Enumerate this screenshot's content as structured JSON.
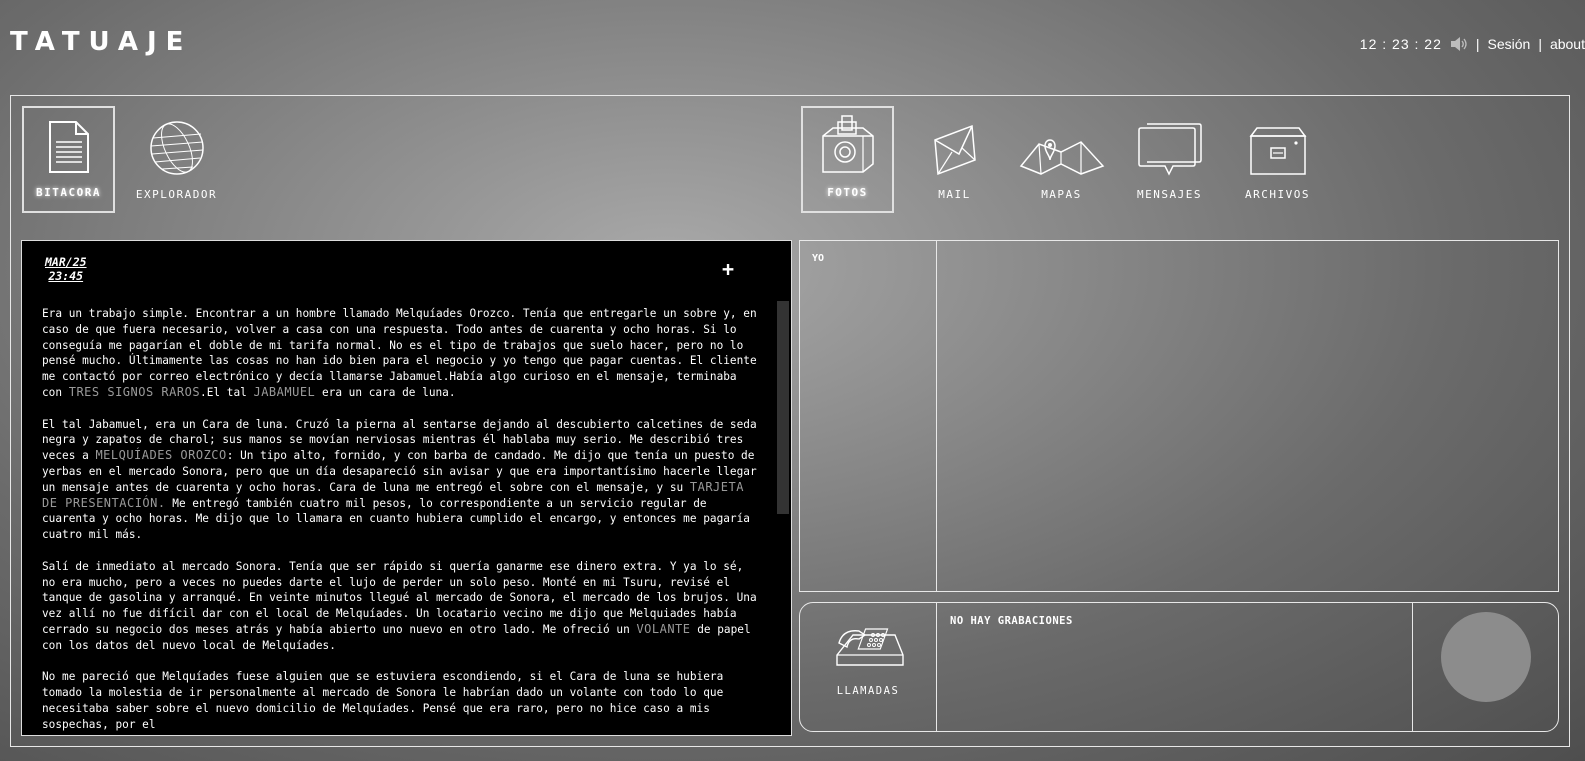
{
  "header": {
    "logo": "TATUAJE",
    "clock": "12 : 23 : 22",
    "separator": "|",
    "session_link": "Sesión",
    "about_link": "about",
    "speaker_icon": "speaker-icon"
  },
  "apps_left": [
    {
      "label": "BITACORA",
      "icon": "document-icon",
      "selected": true
    },
    {
      "label": "EXPLORADOR",
      "icon": "globe-icon",
      "selected": false
    }
  ],
  "apps_right": [
    {
      "label": "FOTOS",
      "icon": "camera-icon",
      "selected": true
    },
    {
      "label": "MAIL",
      "icon": "envelope-icon",
      "selected": false
    },
    {
      "label": "MAPAS",
      "icon": "map-icon",
      "selected": false
    },
    {
      "label": "MENSAJES",
      "icon": "chat-bubble-icon",
      "selected": false
    },
    {
      "label": "ARCHIVOS",
      "icon": "file-cabinet-icon",
      "selected": false
    }
  ],
  "log": {
    "date": "MAR/25",
    "time": "23:45",
    "plus": "+",
    "p1": {
      "a": "Era un trabajo simple. Encontrar a un hombre llamado Melquíades Orozco. Tenía que entregarle un sobre y, en caso de que fuera necesario, volver a casa con una respuesta. Todo antes de cuarenta y ocho horas. Si lo conseguía me pagarían el doble de mi tarifa normal. No es el tipo de trabajos que suelo hacer, pero no lo pensé mucho. Últimamente las cosas no han ido bien para el negocio y yo tengo que pagar cuentas. El cliente me contactó por correo electrónico y decía llamarse Jabamuel.Había algo curioso en el mensaje, terminaba con ",
      "kw1": "TRES SIGNOS RAROS",
      "b": ".El tal ",
      "kw2": "JABAMUEL",
      "c": " era un cara de luna."
    },
    "p2": {
      "a": "El tal Jabamuel, era un Cara de luna. Cruzó la pierna al sentarse dejando al descubierto calcetines de seda negra y zapatos de charol; sus manos se movían nerviosas mientras él hablaba muy serio. Me describió tres veces a ",
      "kw1": "MELQUÍADES OROZCO",
      "b": ": Un tipo alto, fornido, y con barba de candado. Me dijo que tenía un puesto de yerbas en el mercado Sonora, pero que un día desapareció sin avisar y que era importantísimo hacerle llegar un mensaje antes de cuarenta y ocho horas. Cara de luna me entregó el sobre con el mensaje, y su ",
      "kw2": "TARJETA DE PRESENTACIÓN.",
      "c": " Me entregó también cuatro mil pesos, lo correspondiente a un servicio regular de cuarenta y ocho horas. Me dijo que lo llamara en cuanto hubiera cumplido el encargo, y entonces me pagaría cuatro mil más."
    },
    "p3": {
      "a": "Salí de inmediato al mercado Sonora. Tenía que ser rápido si quería ganarme ese dinero extra. Y ya lo sé, no era mucho, pero a veces no puedes darte el lujo de perder un solo peso. Monté en mi Tsuru, revisé el tanque de gasolina y arranqué. En veinte minutos llegué al mercado de Sonora, el mercado de los brujos. Una vez allí no fue difícil dar con el local de Melquíades. Un locatario vecino me dijo que Melquiades había cerrado su negocio dos meses atrás y había abierto uno nuevo en otro lado. Me ofreció un ",
      "kw1": "VOLANTE",
      "b": " de papel con los datos del nuevo local de Melquíades."
    },
    "p4": "No me pareció que Melquíades fuese alguien que se estuviera escondiendo, si el Cara de luna se hubiera tomado la molestia de ir personalmente al mercado de Sonora le habrían dado un volante con todo lo que necesitaba saber sobre el nuevo domicilio de Melquíades. Pensé que era raro, pero no hice caso a mis sospechas, por el"
  },
  "photos": {
    "album_label": "YO"
  },
  "calls": {
    "label": "LLAMADAS",
    "status": "NO HAY GRABACIONES"
  },
  "colors": {
    "keyword": "#9a9a9a",
    "log_background": "#000000",
    "record_button": "#8c8c8c"
  }
}
